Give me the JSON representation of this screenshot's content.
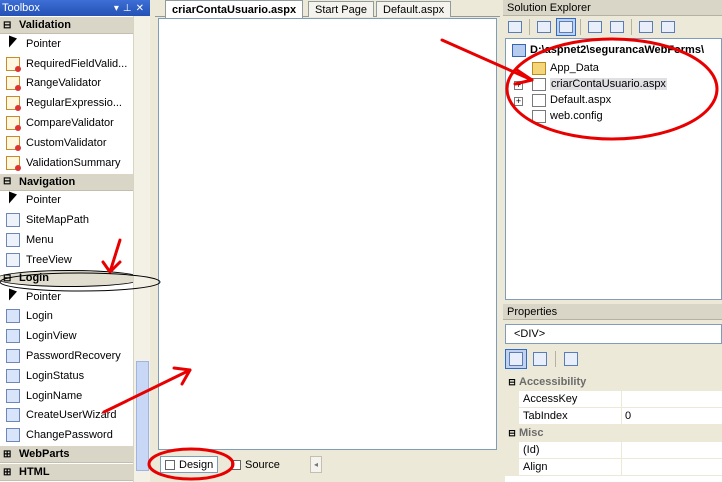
{
  "toolbox": {
    "title": "Toolbox",
    "title_buttons": [
      "▾",
      "⊥",
      "✕"
    ],
    "categories": [
      {
        "sign": "⊟",
        "label": "Validation",
        "items": [
          {
            "label": "Pointer",
            "icon": "pointer-icon"
          },
          {
            "label": "RequiredFieldValid...",
            "icon": "required-field-validator-icon"
          },
          {
            "label": "RangeValidator",
            "icon": "range-validator-icon"
          },
          {
            "label": "RegularExpressio...",
            "icon": "regular-expression-validator-icon"
          },
          {
            "label": "CompareValidator",
            "icon": "compare-validator-icon"
          },
          {
            "label": "CustomValidator",
            "icon": "custom-validator-icon"
          },
          {
            "label": "ValidationSummary",
            "icon": "validation-summary-icon"
          }
        ]
      },
      {
        "sign": "⊟",
        "label": "Navigation",
        "items": [
          {
            "label": "Pointer",
            "icon": "pointer-icon"
          },
          {
            "label": "SiteMapPath",
            "icon": "sitemappath-icon"
          },
          {
            "label": "Menu",
            "icon": "menu-icon"
          },
          {
            "label": "TreeView",
            "icon": "treeview-icon"
          }
        ]
      },
      {
        "sign": "⊟",
        "label": "Login",
        "items": [
          {
            "label": "Pointer",
            "icon": "pointer-icon"
          },
          {
            "label": "Login",
            "icon": "login-icon"
          },
          {
            "label": "LoginView",
            "icon": "loginview-icon"
          },
          {
            "label": "PasswordRecovery",
            "icon": "password-recovery-icon"
          },
          {
            "label": "LoginStatus",
            "icon": "loginstatus-icon"
          },
          {
            "label": "LoginName",
            "icon": "loginname-icon"
          },
          {
            "label": "CreateUserWizard",
            "icon": "create-user-wizard-icon"
          },
          {
            "label": "ChangePassword",
            "icon": "change-password-icon"
          }
        ]
      },
      {
        "sign": "⊞",
        "label": "WebParts",
        "items": []
      },
      {
        "sign": "⊞",
        "label": "HTML",
        "items": []
      }
    ]
  },
  "documents": {
    "tabs": [
      {
        "label": "criarContaUsuario.aspx",
        "active": true
      },
      {
        "label": "Start Page",
        "active": false
      },
      {
        "label": "Default.aspx",
        "active": false
      }
    ],
    "views": {
      "design": "Design",
      "source": "Source"
    }
  },
  "solution_explorer": {
    "title": "Solution Explorer",
    "root": "D:\\aspnet2\\segurancaWebForms\\",
    "nodes": [
      {
        "label": "App_Data",
        "icon": "folder-icon"
      },
      {
        "label": "criarContaUsuario.aspx",
        "icon": "aspx-file-icon"
      },
      {
        "label": "Default.aspx",
        "icon": "aspx-file-icon"
      },
      {
        "label": "web.config",
        "icon": "config-file-icon"
      }
    ]
  },
  "properties": {
    "title": "Properties",
    "object": "<DIV>",
    "rows": [
      {
        "type": "category",
        "sign": "⊟",
        "label": "Accessibility"
      },
      {
        "type": "prop",
        "name": "AccessKey",
        "value": ""
      },
      {
        "type": "prop",
        "name": "TabIndex",
        "value": "0"
      },
      {
        "type": "category",
        "sign": "⊟",
        "label": "Misc"
      },
      {
        "type": "prop",
        "name": "(Id)",
        "value": ""
      },
      {
        "type": "prop",
        "name": "Align",
        "value": ""
      }
    ]
  },
  "colors": {
    "annotation_red": "#e80000",
    "toolbox_title": "#2451b5",
    "selection": "#316ac5"
  }
}
